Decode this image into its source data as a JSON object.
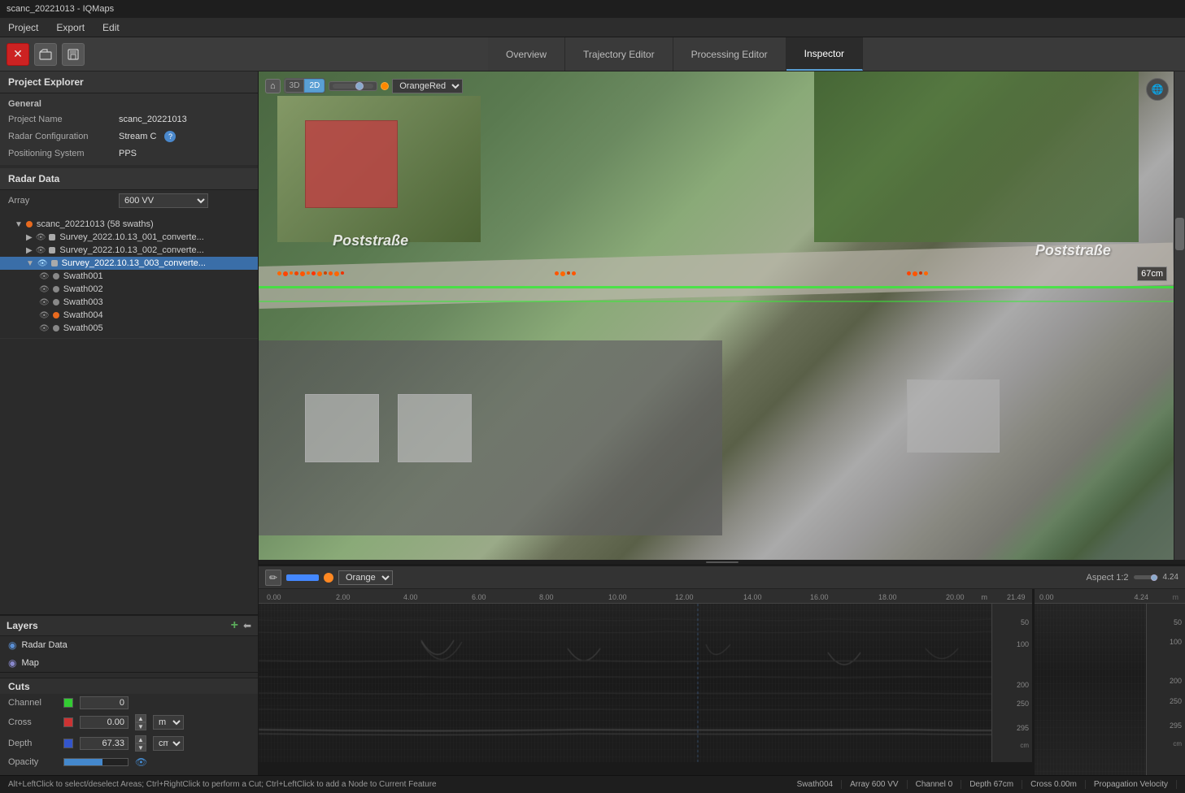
{
  "titlebar": {
    "title": "scanc_20221013 - IQMaps"
  },
  "menubar": {
    "items": [
      "Project",
      "Export",
      "Edit"
    ]
  },
  "toolbar": {
    "close_label": "✕",
    "open_label": "📁",
    "save_label": "💾"
  },
  "tabs": {
    "overview": "Overview",
    "trajectory_editor": "Trajectory Editor",
    "processing_editor": "Processing Editor",
    "inspector": "Inspector"
  },
  "project_explorer": {
    "header": "Project Explorer",
    "general_header": "General",
    "project_name_label": "Project Name",
    "project_name_value": "scanc_20221013",
    "radar_config_label": "Radar Configuration",
    "radar_config_value": "Stream C",
    "positioning_label": "Positioning System",
    "positioning_value": "PPS",
    "radar_data_header": "Radar Data",
    "array_label": "Array",
    "array_value": "600 VV",
    "tree": {
      "root": "scanc_20221013 (58 swaths)",
      "survey1": "Survey_2022.10.13_001_converte...",
      "survey2": "Survey_2022.10.13_002_converte...",
      "survey3": "Survey_2022.10.13_003_converte...",
      "swath1": "Swath001",
      "swath2": "Swath002",
      "swath3": "Swath003",
      "swath4": "Swath004",
      "swath5": "Swath005"
    }
  },
  "layers": {
    "header": "Layers",
    "radar_data": "Radar Data",
    "map": "Map",
    "add_button": "+"
  },
  "cuts": {
    "header": "Cuts",
    "channel_label": "Channel",
    "channel_value": "0",
    "cross_label": "Cross",
    "cross_value": "0.00",
    "cross_unit": "m",
    "depth_label": "Depth",
    "depth_value": "67.33",
    "depth_unit": "cm",
    "opacity_label": "Opacity"
  },
  "map_view": {
    "view_3d": "3D",
    "view_2d": "2D",
    "color_scheme": "OrangeRed",
    "road_text_left": "Poststraße",
    "road_text_right": "Poststraße",
    "distance_label": "67cm"
  },
  "bottom_toolbar": {
    "color_scheme": "Orange",
    "aspect_label": "Aspect 1:2"
  },
  "ruler": {
    "ticks_m": [
      "0.00",
      "2.00",
      "4.00",
      "6.00",
      "8.00",
      "10.00",
      "12.00",
      "14.00",
      "16.00",
      "18.00",
      "20.00",
      "21.49"
    ],
    "unit_m": "m",
    "depth_ticks": [
      "50",
      "100",
      "200",
      "250",
      "295"
    ],
    "depth_unit": "cm",
    "secondary_ticks_m": [
      "0.00",
      "4.24"
    ],
    "secondary_depth_ticks": [
      "50",
      "100",
      "200",
      "250",
      "295"
    ],
    "secondary_depth_unit": "cm"
  },
  "statusbar": {
    "message": "Alt+LeftClick to select/deselect Areas; Ctrl+RightClick to perform a Cut; Ctrl+LeftClick to add a Node to Current Feature",
    "swath": "Swath004",
    "array": "Array 600 VV",
    "channel_label": "Channel",
    "channel_value": "0",
    "depth_label": "Depth",
    "depth_value": "67cm",
    "cross_label": "Cross",
    "cross_value": "0.00m",
    "propagation": "Propagation Velocity"
  }
}
